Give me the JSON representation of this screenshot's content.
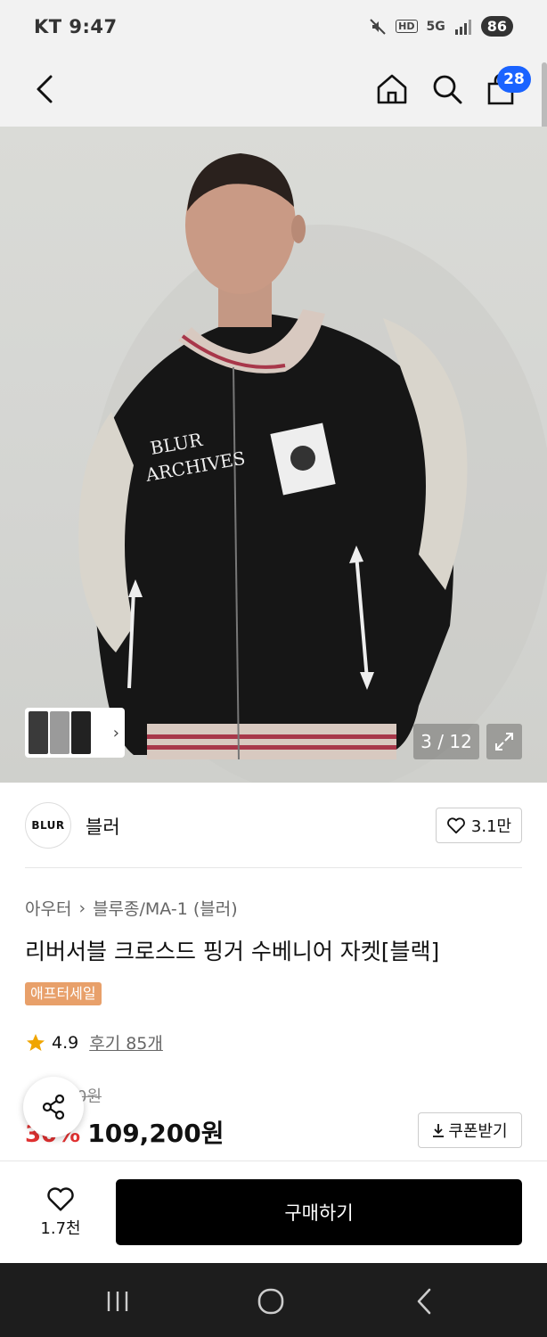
{
  "status": {
    "carrier_time": "KT 9:47",
    "network": "5G",
    "hd": "HD",
    "battery": "86"
  },
  "header": {
    "cart_count": "28"
  },
  "gallery": {
    "counter": "3 / 12"
  },
  "brand": {
    "logo_text": "BLUR",
    "name": "블러",
    "likes": "3.1만"
  },
  "product": {
    "category": "아우터",
    "subcategory": "블루종/MA-1 (블러)",
    "title": "리버서블 크로스드 핑거 수베니어 자켓[블랙]",
    "sale_badge": "애프터세일",
    "rating": "4.9",
    "reviews": "후기 85개",
    "original_price": "0원",
    "discount": "30%",
    "price": "109,200원",
    "coupon_label": "쿠폰받기"
  },
  "bottom": {
    "wish_count": "1.7천",
    "buy_label": "구매하기"
  },
  "colors": {
    "accent_blue": "#1a63ff",
    "discount_red": "#e03131",
    "sale_orange": "#e8a06a"
  }
}
